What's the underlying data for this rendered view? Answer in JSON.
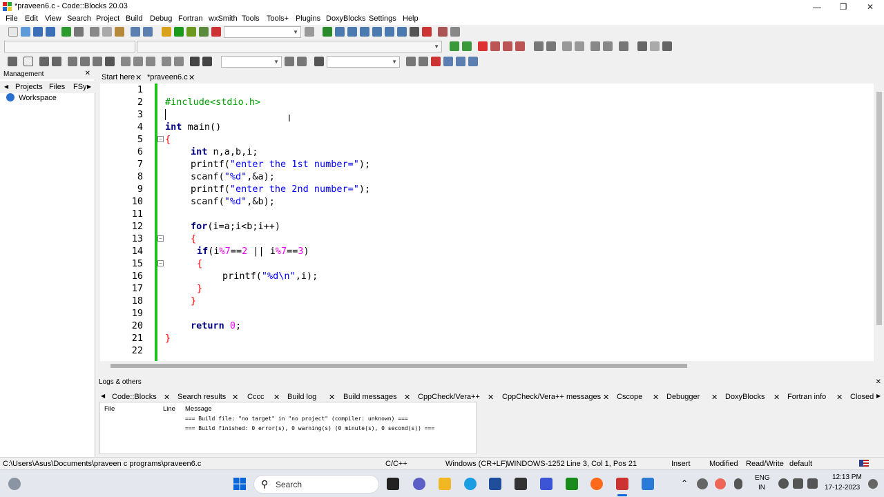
{
  "window": {
    "title": "*praveen6.c - Code::Blocks 20.03",
    "minimize": "—",
    "maximize": "❐",
    "close": "✕"
  },
  "menu": [
    "File",
    "Edit",
    "View",
    "Search",
    "Project",
    "Build",
    "Debug",
    "Fortran",
    "wxSmith",
    "Tools",
    "Tools+",
    "Plugins",
    "DoxyBlocks",
    "Settings",
    "Help"
  ],
  "management": {
    "title": "Management",
    "close": "✕",
    "tabs": [
      "Projects",
      "Files",
      "FSy"
    ],
    "workspace": "Workspace"
  },
  "editor_tabs": [
    {
      "label": "Start here",
      "close": "✕"
    },
    {
      "label": "*praveen6.c",
      "close": "✕"
    }
  ],
  "code_lines": [
    {
      "n": "1"
    },
    {
      "n": "2"
    },
    {
      "n": "3"
    },
    {
      "n": "4"
    },
    {
      "n": "5"
    },
    {
      "n": "6"
    },
    {
      "n": "7"
    },
    {
      "n": "8"
    },
    {
      "n": "9"
    },
    {
      "n": "10"
    },
    {
      "n": "11"
    },
    {
      "n": "12"
    },
    {
      "n": "13"
    },
    {
      "n": "14"
    },
    {
      "n": "15"
    },
    {
      "n": "16"
    },
    {
      "n": "17"
    },
    {
      "n": "18"
    },
    {
      "n": "19"
    },
    {
      "n": "20"
    },
    {
      "n": "21"
    },
    {
      "n": "22"
    }
  ],
  "code": {
    "l2": "#include<stdio.h>",
    "l4_kw": "int",
    "l4_rest": " main()",
    "l5": "{",
    "l6_kw": "int",
    "l6_rest": " n,a,b,i;",
    "l7_fn": "printf(",
    "l7_str": "\"enter the 1st number=\"",
    "l7_end": ");",
    "l8_fn": "scanf(",
    "l8_str": "\"%d\"",
    "l8_end": ",&a);",
    "l9_fn": "printf(",
    "l9_str": "\"enter the 2nd number=\"",
    "l9_end": ");",
    "l10_fn": "scanf(",
    "l10_str": "\"%d\"",
    "l10_end": ",&b);",
    "l12_kw": "for",
    "l12_rest": "(i=a;i<b;i++)",
    "l13": "{",
    "l14_kw": "if",
    "l14_a": "(i",
    "l14_op1": "%",
    "l14_num1": "7",
    "l14_b": "==",
    "l14_num2": "2",
    "l14_c": " || i",
    "l14_op2": "%",
    "l14_num3": "7",
    "l14_d": "==",
    "l14_num4": "3",
    "l14_e": ")",
    "l15": "{",
    "l16_fn": "printf(",
    "l16_str": "\"%d\\n\"",
    "l16_end": ",i);",
    "l17": "}",
    "l18": "}",
    "l20_kw": "return",
    "l20_num": " 0",
    "l20_end": ";",
    "l21": "}"
  },
  "logs": {
    "title": "Logs & others",
    "close": "✕",
    "tabs": [
      "Code::Blocks",
      "Search results",
      "Cccc",
      "Build log",
      "Build messages",
      "CppCheck/Vera++",
      "CppCheck/Vera++ messages",
      "Cscope",
      "Debugger",
      "DoxyBlocks",
      "Fortran info",
      "Closed"
    ],
    "columns": [
      "File",
      "Line",
      "Message"
    ],
    "messages": [
      "=== Build file: \"no target\" in \"no project\" (compiler: unknown) ===",
      "=== Build finished: 0 error(s), 0 warning(s) (0 minute(s), 0 second(s)) ==="
    ]
  },
  "status": {
    "path": "C:\\Users\\Asus\\Documents\\praveen c programs\\praveen6.c",
    "language": "C/C++",
    "eol": "Windows (CR+LF)",
    "encoding": "WINDOWS-1252",
    "position": "Line 3, Col 1, Pos 21",
    "mode": "Insert",
    "modified": "Modified",
    "access": "Read/Write",
    "profile": "default"
  },
  "taskbar": {
    "search_label": "Search",
    "lang_top": "ENG",
    "lang_bottom": "IN",
    "time": "12:13 PM",
    "date": "17-12-2023"
  },
  "colors": {
    "keyword": "#000080",
    "string": "#0000ff",
    "number": "#f000f0",
    "preprocessor": "#00a000",
    "change_bar": "#1dc21d"
  }
}
